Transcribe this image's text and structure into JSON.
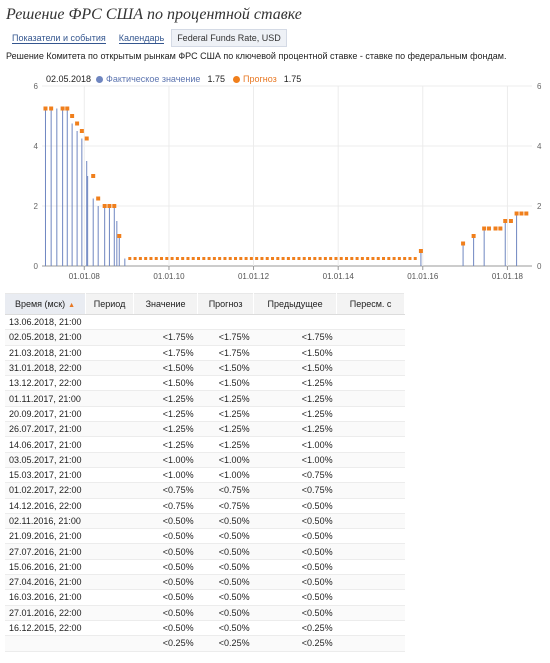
{
  "page_title": "Решение ФРС США по процентной ставке",
  "tabs": [
    {
      "label": "Показатели и события"
    },
    {
      "label": "Календарь"
    },
    {
      "label": "Federal Funds Rate, USD"
    }
  ],
  "description": "Решение Комитета по открытым рынкам ФРС США по ключевой процентной ставке - ставке по федеральным фондам.",
  "legend": {
    "date": "02.05.2018",
    "actual_label": "Фактическое значение",
    "actual_value": "1.75",
    "forecast_label": "Прогноз",
    "forecast_value": "1.75",
    "actual_color": "#6f86c0",
    "forecast_color": "#f07f1c"
  },
  "chart_data": {
    "type": "bar",
    "y_ticks": [
      "0",
      "2",
      "4",
      "6"
    ],
    "ylim": [
      0,
      6
    ],
    "x_tick_labels": [
      "01.01.08",
      "01.01.10",
      "01.01.12",
      "01.01.14",
      "01.01.16",
      "01.01.18"
    ],
    "xlim": [
      "2007-01-01",
      "2018-08-01"
    ],
    "grid": true,
    "series": [
      {
        "name": "Фактическое значение",
        "values": [
          [
            "2007-01-31",
            5.25
          ],
          [
            "2007-03-21",
            5.25
          ],
          [
            "2007-05-09",
            5.25
          ],
          [
            "2007-06-28",
            5.25
          ],
          [
            "2007-08-07",
            5.25
          ],
          [
            "2007-09-18",
            4.75
          ],
          [
            "2007-10-31",
            4.5
          ],
          [
            "2007-12-11",
            4.25
          ],
          [
            "2008-01-22",
            3.5
          ],
          [
            "2008-01-30",
            3.0
          ],
          [
            "2008-03-18",
            2.25
          ],
          [
            "2008-04-30",
            2.0
          ],
          [
            "2008-06-25",
            2.0
          ],
          [
            "2008-08-05",
            2.0
          ],
          [
            "2008-09-16",
            2.0
          ],
          [
            "2008-10-08",
            1.5
          ],
          [
            "2008-10-29",
            1.0
          ],
          [
            "2008-12-16",
            0.25
          ],
          [
            "2015-12-16",
            0.5
          ],
          [
            "2016-12-14",
            0.75
          ],
          [
            "2017-03-15",
            1.0
          ],
          [
            "2017-06-14",
            1.25
          ],
          [
            "2017-12-13",
            1.5
          ],
          [
            "2018-03-21",
            1.75
          ]
        ]
      },
      {
        "name": "Прогноз",
        "values": [
          [
            "2007-01-31",
            5.25
          ],
          [
            "2007-03-21",
            5.25
          ],
          [
            "2007-06-28",
            5.25
          ],
          [
            "2007-08-07",
            5.25
          ],
          [
            "2007-09-18",
            5.0
          ],
          [
            "2007-10-31",
            4.75
          ],
          [
            "2007-12-11",
            4.5
          ],
          [
            "2008-01-22",
            4.25
          ],
          [
            "2008-03-18",
            3.0
          ],
          [
            "2008-04-30",
            2.25
          ],
          [
            "2008-06-25",
            2.0
          ],
          [
            "2008-08-05",
            2.0
          ],
          [
            "2008-09-16",
            2.0
          ],
          [
            "2008-10-29",
            1.0
          ],
          [
            "2015-12-16",
            0.5
          ],
          [
            "2016-12-14",
            0.75
          ],
          [
            "2017-03-15",
            1.0
          ],
          [
            "2017-06-14",
            1.25
          ],
          [
            "2017-07-26",
            1.25
          ],
          [
            "2017-09-20",
            1.25
          ],
          [
            "2017-11-01",
            1.25
          ],
          [
            "2017-12-13",
            1.5
          ],
          [
            "2018-01-31",
            1.5
          ],
          [
            "2018-03-21",
            1.75
          ],
          [
            "2018-05-02",
            1.75
          ],
          [
            "2018-06-13",
            1.75
          ]
        ]
      }
    ]
  },
  "table": {
    "headers": [
      "Время (мск)",
      "Период",
      "Значение",
      "Прогноз",
      "Предыдущее",
      "Пересм. с"
    ],
    "rows": [
      [
        "13.06.2018, 21:00",
        "",
        "",
        "",
        "",
        ""
      ],
      [
        "02.05.2018, 21:00",
        "",
        "<1.75%",
        "<1.75%",
        "<1.75%",
        ""
      ],
      [
        "21.03.2018, 21:00",
        "",
        "<1.75%",
        "<1.75%",
        "<1.50%",
        ""
      ],
      [
        "31.01.2018, 22:00",
        "",
        "<1.50%",
        "<1.50%",
        "<1.50%",
        ""
      ],
      [
        "13.12.2017, 22:00",
        "",
        "<1.50%",
        "<1.50%",
        "<1.25%",
        ""
      ],
      [
        "01.11.2017, 21:00",
        "",
        "<1.25%",
        "<1.25%",
        "<1.25%",
        ""
      ],
      [
        "20.09.2017, 21:00",
        "",
        "<1.25%",
        "<1.25%",
        "<1.25%",
        ""
      ],
      [
        "26.07.2017, 21:00",
        "",
        "<1.25%",
        "<1.25%",
        "<1.25%",
        ""
      ],
      [
        "14.06.2017, 21:00",
        "",
        "<1.25%",
        "<1.25%",
        "<1.00%",
        ""
      ],
      [
        "03.05.2017, 21:00",
        "",
        "<1.00%",
        "<1.00%",
        "<1.00%",
        ""
      ],
      [
        "15.03.2017, 21:00",
        "",
        "<1.00%",
        "<1.00%",
        "<0.75%",
        ""
      ],
      [
        "01.02.2017, 22:00",
        "",
        "<0.75%",
        "<0.75%",
        "<0.75%",
        ""
      ],
      [
        "14.12.2016, 22:00",
        "",
        "<0.75%",
        "<0.75%",
        "<0.50%",
        ""
      ],
      [
        "02.11.2016, 21:00",
        "",
        "<0.50%",
        "<0.50%",
        "<0.50%",
        ""
      ],
      [
        "21.09.2016, 21:00",
        "",
        "<0.50%",
        "<0.50%",
        "<0.50%",
        ""
      ],
      [
        "27.07.2016, 21:00",
        "",
        "<0.50%",
        "<0.50%",
        "<0.50%",
        ""
      ],
      [
        "15.06.2016, 21:00",
        "",
        "<0.50%",
        "<0.50%",
        "<0.50%",
        ""
      ],
      [
        "27.04.2016, 21:00",
        "",
        "<0.50%",
        "<0.50%",
        "<0.50%",
        ""
      ],
      [
        "16.03.2016, 21:00",
        "",
        "<0.50%",
        "<0.50%",
        "<0.50%",
        ""
      ],
      [
        "27.01.2016, 22:00",
        "",
        "<0.50%",
        "<0.50%",
        "<0.50%",
        ""
      ],
      [
        "16.12.2015, 22:00",
        "",
        "<0.50%",
        "<0.50%",
        "<0.25%",
        ""
      ],
      [
        "",
        "",
        "<0.25%",
        "<0.25%",
        "<0.25%",
        ""
      ]
    ]
  }
}
